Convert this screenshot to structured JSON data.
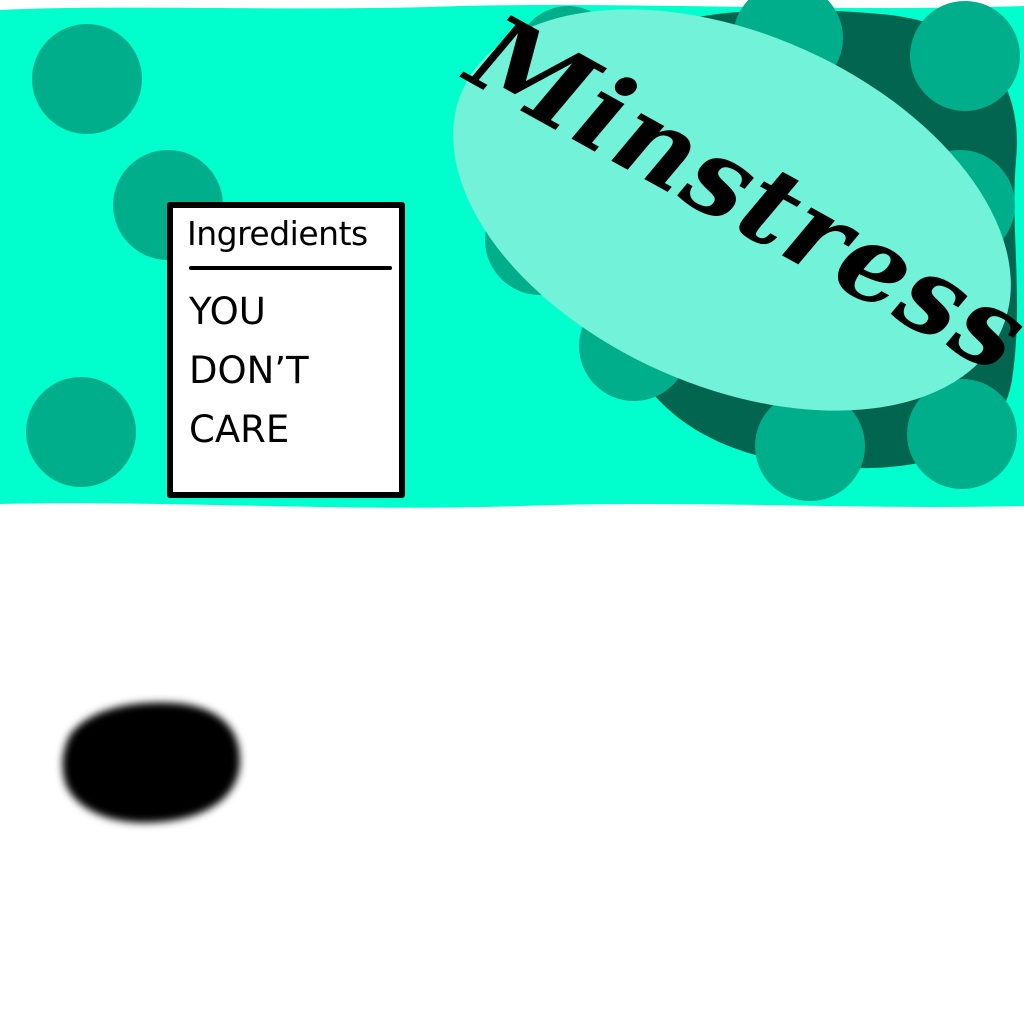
{
  "brand": {
    "name": "Minstress"
  },
  "ingredients_label": {
    "heading": "Ingredients",
    "lines": [
      "YOU",
      "DON’T",
      "CARE"
    ]
  },
  "colors": {
    "wrapper_teal": "#00ffcc",
    "dot_teal": "#00ae8c",
    "dark_blob": "#016550",
    "oval_light": "#72f2d8",
    "ink": "#000000",
    "background": "#ffffff"
  }
}
